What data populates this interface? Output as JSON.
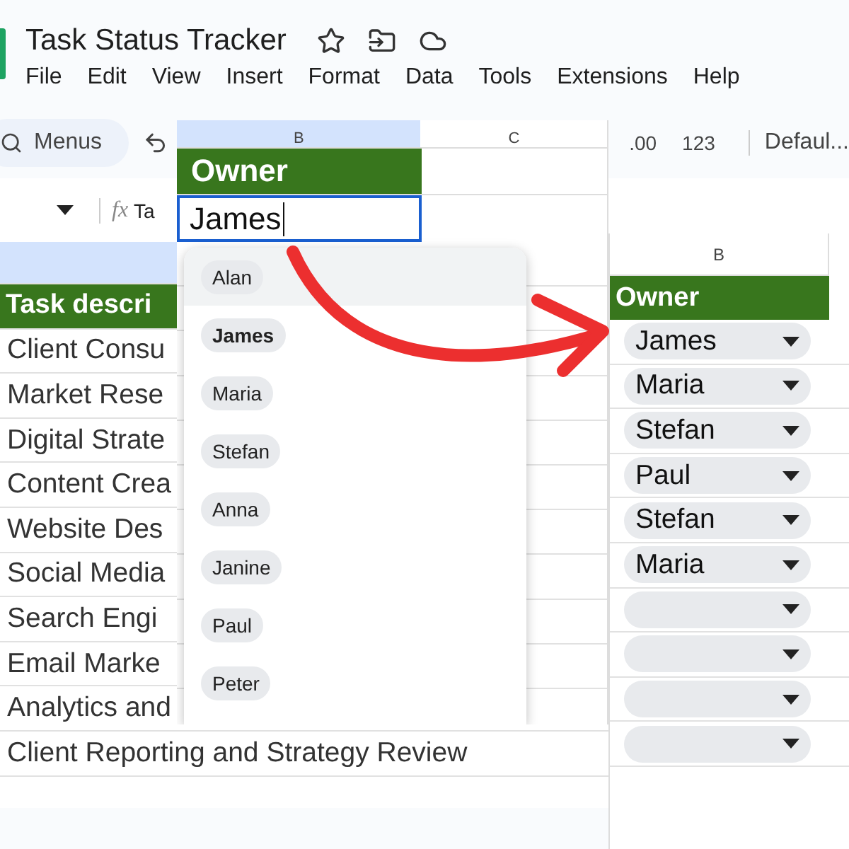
{
  "document": {
    "title": "Task Status Tracker"
  },
  "menu": [
    "File",
    "Edit",
    "View",
    "Insert",
    "Format",
    "Data",
    "Tools",
    "Extensions",
    "Help"
  ],
  "toolbar": {
    "search_placeholder": "Menus",
    "decimal_button": ".00",
    "number_format": "123",
    "font": "Defaul..."
  },
  "formula_bar": {
    "function_label": "fx",
    "content": "Ta"
  },
  "sheet": {
    "header": "Task descri",
    "rows": [
      "Client Consu",
      "Market Rese",
      "Digital Strate",
      "Content Crea",
      "Website Des",
      "Social Media",
      "Search Engi",
      "Email Marke",
      "Analytics and",
      "Client Reporting and Strategy Review"
    ]
  },
  "editor_inset": {
    "columns": [
      "B",
      "C"
    ],
    "header": "Owner",
    "value": "James",
    "options": [
      {
        "label": "Alan",
        "selected": false,
        "highlighted": true
      },
      {
        "label": "James",
        "selected": true,
        "highlighted": false
      },
      {
        "label": "Maria",
        "selected": false,
        "highlighted": false
      },
      {
        "label": "Stefan",
        "selected": false,
        "highlighted": false
      },
      {
        "label": "Anna",
        "selected": false,
        "highlighted": false
      },
      {
        "label": "Janine",
        "selected": false,
        "highlighted": false
      },
      {
        "label": "Paul",
        "selected": false,
        "highlighted": false
      },
      {
        "label": "Peter",
        "selected": false,
        "highlighted": false
      }
    ]
  },
  "result_inset": {
    "column": "B",
    "header": "Owner",
    "rows": [
      {
        "value": "James"
      },
      {
        "value": "Maria"
      },
      {
        "value": "Stefan"
      },
      {
        "value": "Paul"
      },
      {
        "value": "Stefan"
      },
      {
        "value": "Maria"
      },
      {},
      {},
      {},
      {}
    ]
  }
}
